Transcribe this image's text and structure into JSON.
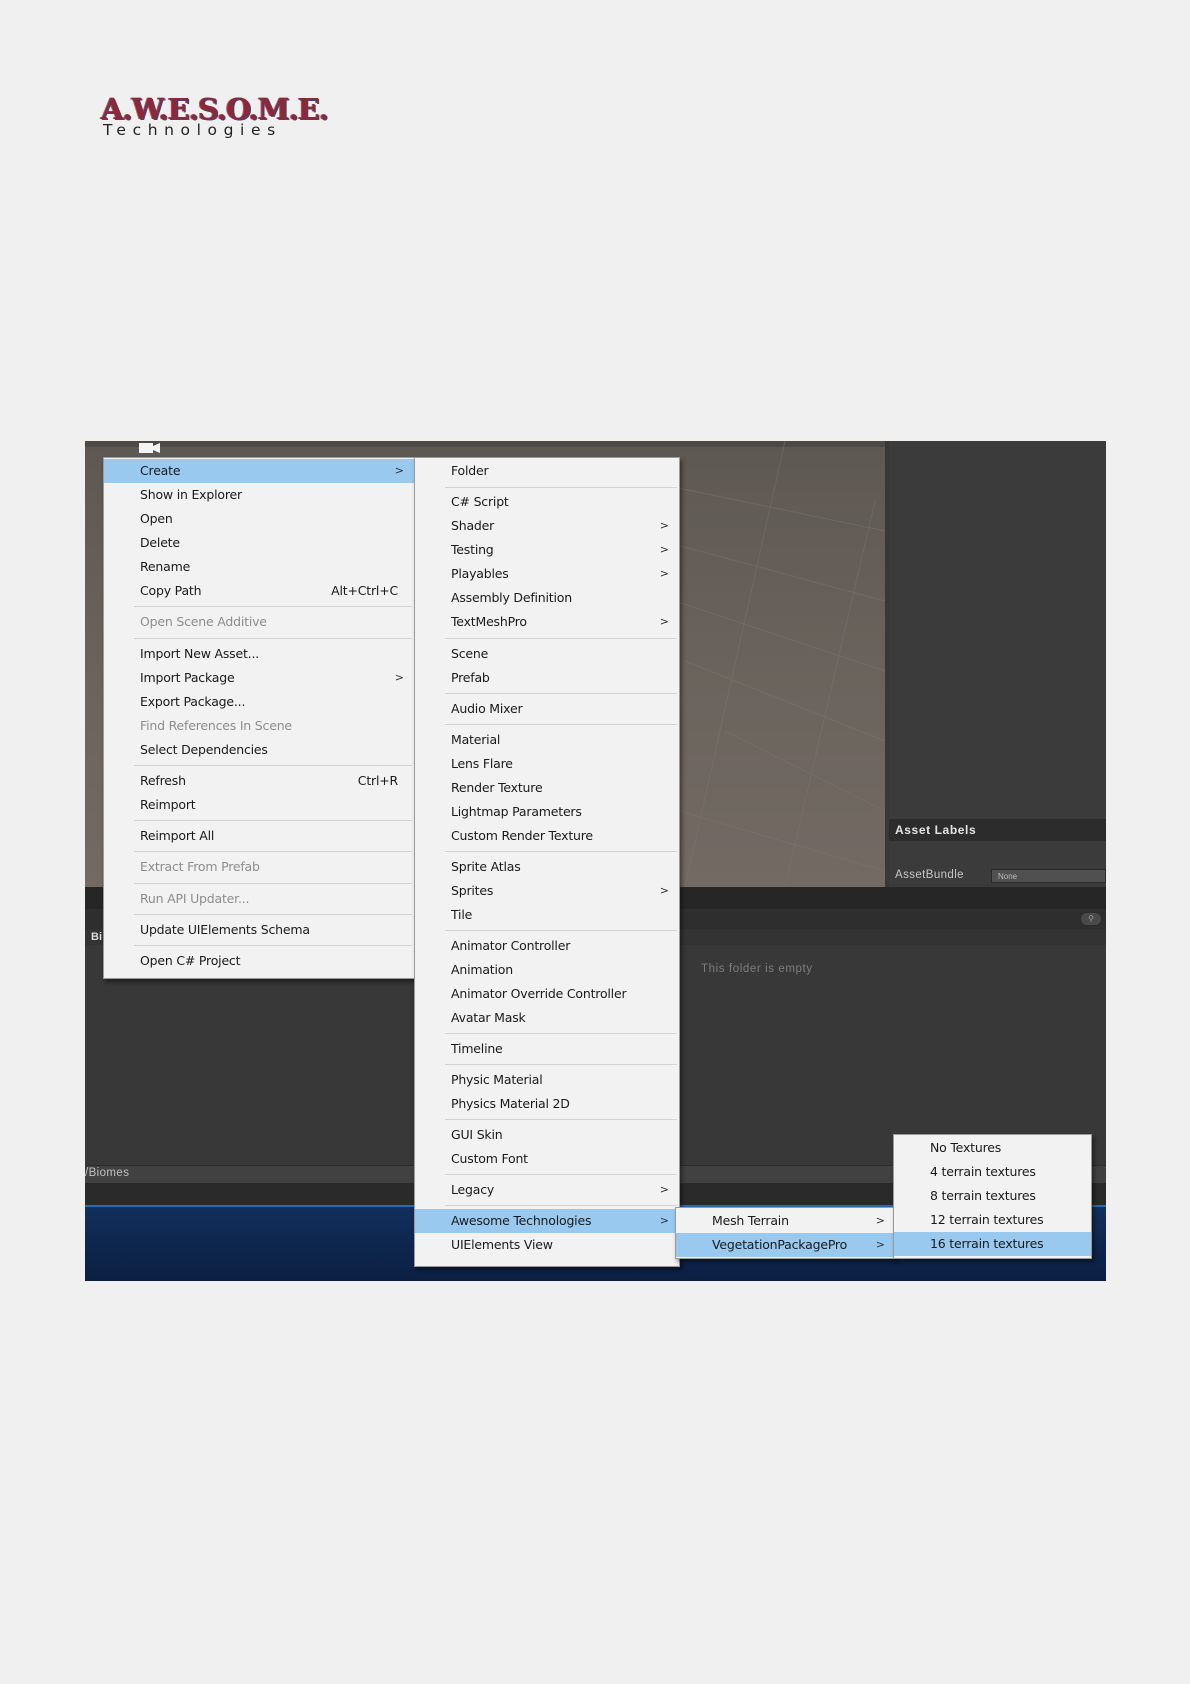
{
  "logo": {
    "title": "A.W.E.S.O.M.E.",
    "subtitle": "Technologies"
  },
  "inspector": {
    "asset_labels": "Asset Labels",
    "assetbundle_label": "AssetBundle",
    "assetbundle_value": "None"
  },
  "project": {
    "tab_label": "Bi",
    "empty_message": "This folder is empty",
    "path": "/Biomes",
    "search_icon": "search-icon"
  },
  "context_menu": {
    "create": "Create",
    "show_in_explorer": "Show in Explorer",
    "open": "Open",
    "delete": "Delete",
    "rename": "Rename",
    "copy_path": "Copy Path",
    "copy_path_shortcut": "Alt+Ctrl+C",
    "open_scene_additive": "Open Scene Additive",
    "import_new_asset": "Import New Asset...",
    "import_package": "Import Package",
    "export_package": "Export Package...",
    "find_references": "Find References In Scene",
    "select_dependencies": "Select Dependencies",
    "refresh": "Refresh",
    "refresh_shortcut": "Ctrl+R",
    "reimport": "Reimport",
    "reimport_all": "Reimport All",
    "extract_from_prefab": "Extract From Prefab",
    "run_api_updater": "Run API Updater...",
    "update_uielements_schema": "Update UIElements Schema",
    "open_csharp_project": "Open C# Project",
    "arrow": ">"
  },
  "create_menu": {
    "folder": "Folder",
    "csharp_script": "C# Script",
    "shader": "Shader",
    "testing": "Testing",
    "playables": "Playables",
    "assembly_definition": "Assembly Definition",
    "textmeshpro": "TextMeshPro",
    "scene": "Scene",
    "prefab": "Prefab",
    "audio_mixer": "Audio Mixer",
    "material": "Material",
    "lens_flare": "Lens Flare",
    "render_texture": "Render Texture",
    "lightmap_parameters": "Lightmap Parameters",
    "custom_render_texture": "Custom Render Texture",
    "sprite_atlas": "Sprite Atlas",
    "sprites": "Sprites",
    "tile": "Tile",
    "animator_controller": "Animator Controller",
    "animation": "Animation",
    "animator_override_controller": "Animator Override Controller",
    "avatar_mask": "Avatar Mask",
    "timeline": "Timeline",
    "physic_material": "Physic Material",
    "physics_material_2d": "Physics Material 2D",
    "gui_skin": "GUI Skin",
    "custom_font": "Custom Font",
    "legacy": "Legacy",
    "awesome_technologies": "Awesome Technologies",
    "uielements_view": "UIElements View"
  },
  "awesome_menu": {
    "mesh_terrain": "Mesh Terrain",
    "vegetation_package_pro": "VegetationPackagePro"
  },
  "vpp_menu": {
    "no_textures": "No Textures",
    "t4": "4 terrain textures",
    "t8": "8 terrain textures",
    "t12": "12 terrain textures",
    "t16": "16 terrain textures"
  },
  "colors": {
    "highlight": "#99c9ef",
    "menu_bg": "#f2f2f2",
    "disabled_text": "#8d8d8d",
    "editor_dark": "#383838"
  }
}
